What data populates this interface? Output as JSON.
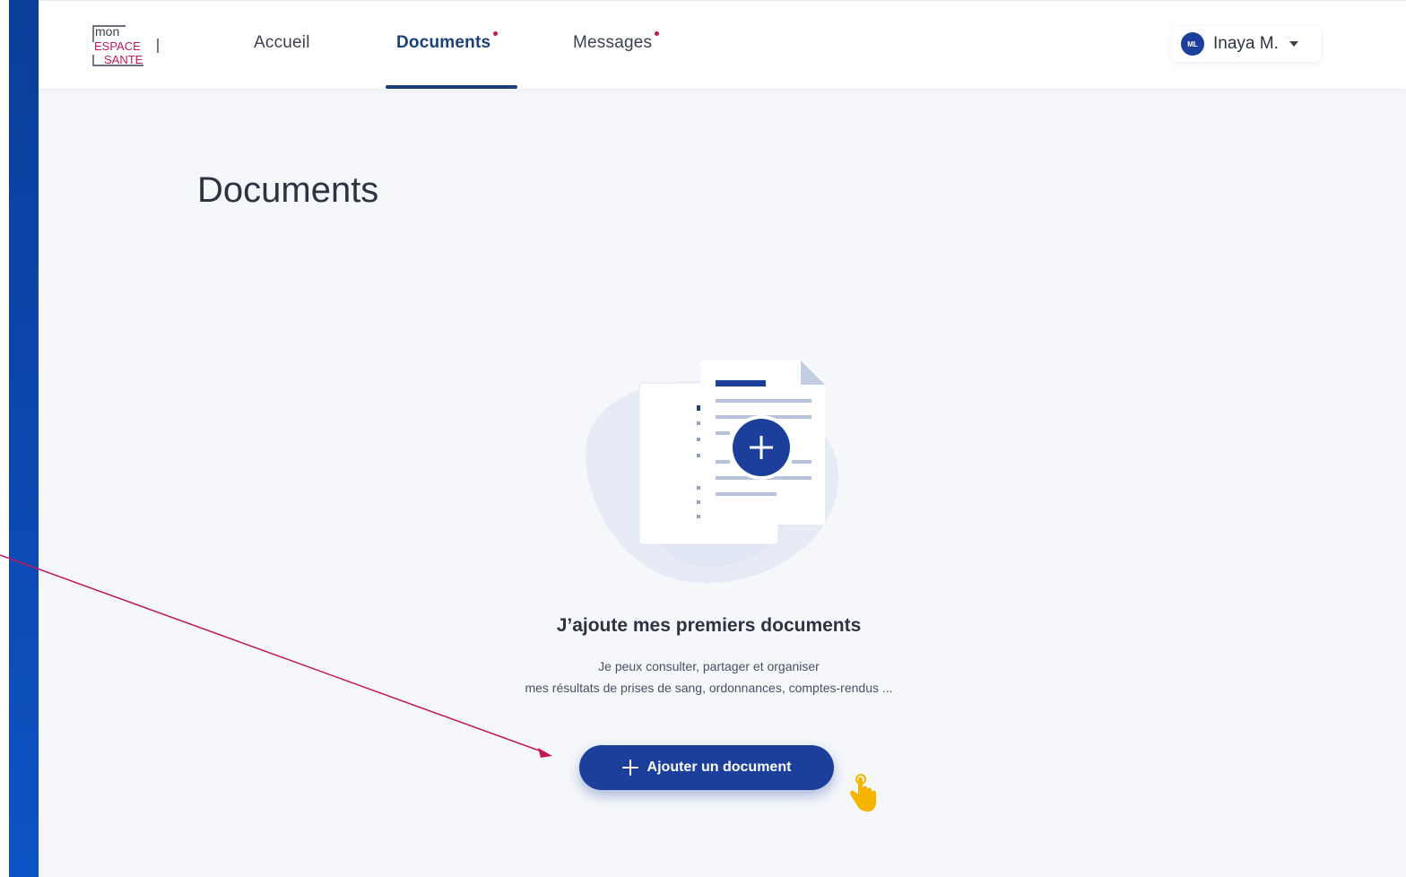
{
  "logo": {
    "line1": "mon",
    "line2": "ESPACE",
    "line3": "SANTE"
  },
  "nav": {
    "items": [
      {
        "label": "Accueil",
        "notification": false
      },
      {
        "label": "Documents",
        "notification": true,
        "active": true
      },
      {
        "label": "Messages",
        "notification": true
      }
    ]
  },
  "user": {
    "initials": "ML",
    "name": "Inaya M."
  },
  "page": {
    "title": "Documents"
  },
  "empty_state": {
    "title": "J’ajoute mes premiers documents",
    "line1": "Je peux consulter, partager et organiser",
    "line2": "mes résultats de prises de sang, ordonnances, comptes-rendus ..."
  },
  "actions": {
    "add_document": "Ajouter un document"
  },
  "colors": {
    "primary": "#1b3f9a",
    "accent_dot": "#c2185b",
    "annotation": "#c2185b",
    "cursor": "#f5b400"
  },
  "icons": [
    "plus-icon",
    "hand-pointer-icon",
    "document-add-icon",
    "chevron-down-icon"
  ]
}
